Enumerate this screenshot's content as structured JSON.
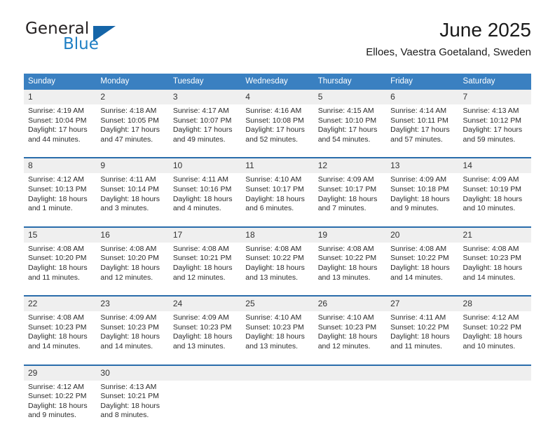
{
  "brand": {
    "word_one": "General",
    "word_two": "Blue",
    "logo_color": "#1565a8"
  },
  "header": {
    "title": "June 2025",
    "subtitle": "Elloes, Vaestra Goetaland, Sweden"
  },
  "calendar": {
    "header_bg": "#3a80c1",
    "weekdays": [
      "Sunday",
      "Monday",
      "Tuesday",
      "Wednesday",
      "Thursday",
      "Friday",
      "Saturday"
    ],
    "weeks": [
      [
        {
          "day": "1",
          "sunrise": "Sunrise: 4:19 AM",
          "sunset": "Sunset: 10:04 PM",
          "daylight": "Daylight: 17 hours and 44 minutes."
        },
        {
          "day": "2",
          "sunrise": "Sunrise: 4:18 AM",
          "sunset": "Sunset: 10:05 PM",
          "daylight": "Daylight: 17 hours and 47 minutes."
        },
        {
          "day": "3",
          "sunrise": "Sunrise: 4:17 AM",
          "sunset": "Sunset: 10:07 PM",
          "daylight": "Daylight: 17 hours and 49 minutes."
        },
        {
          "day": "4",
          "sunrise": "Sunrise: 4:16 AM",
          "sunset": "Sunset: 10:08 PM",
          "daylight": "Daylight: 17 hours and 52 minutes."
        },
        {
          "day": "5",
          "sunrise": "Sunrise: 4:15 AM",
          "sunset": "Sunset: 10:10 PM",
          "daylight": "Daylight: 17 hours and 54 minutes."
        },
        {
          "day": "6",
          "sunrise": "Sunrise: 4:14 AM",
          "sunset": "Sunset: 10:11 PM",
          "daylight": "Daylight: 17 hours and 57 minutes."
        },
        {
          "day": "7",
          "sunrise": "Sunrise: 4:13 AM",
          "sunset": "Sunset: 10:12 PM",
          "daylight": "Daylight: 17 hours and 59 minutes."
        }
      ],
      [
        {
          "day": "8",
          "sunrise": "Sunrise: 4:12 AM",
          "sunset": "Sunset: 10:13 PM",
          "daylight": "Daylight: 18 hours and 1 minute."
        },
        {
          "day": "9",
          "sunrise": "Sunrise: 4:11 AM",
          "sunset": "Sunset: 10:14 PM",
          "daylight": "Daylight: 18 hours and 3 minutes."
        },
        {
          "day": "10",
          "sunrise": "Sunrise: 4:11 AM",
          "sunset": "Sunset: 10:16 PM",
          "daylight": "Daylight: 18 hours and 4 minutes."
        },
        {
          "day": "11",
          "sunrise": "Sunrise: 4:10 AM",
          "sunset": "Sunset: 10:17 PM",
          "daylight": "Daylight: 18 hours and 6 minutes."
        },
        {
          "day": "12",
          "sunrise": "Sunrise: 4:09 AM",
          "sunset": "Sunset: 10:17 PM",
          "daylight": "Daylight: 18 hours and 7 minutes."
        },
        {
          "day": "13",
          "sunrise": "Sunrise: 4:09 AM",
          "sunset": "Sunset: 10:18 PM",
          "daylight": "Daylight: 18 hours and 9 minutes."
        },
        {
          "day": "14",
          "sunrise": "Sunrise: 4:09 AM",
          "sunset": "Sunset: 10:19 PM",
          "daylight": "Daylight: 18 hours and 10 minutes."
        }
      ],
      [
        {
          "day": "15",
          "sunrise": "Sunrise: 4:08 AM",
          "sunset": "Sunset: 10:20 PM",
          "daylight": "Daylight: 18 hours and 11 minutes."
        },
        {
          "day": "16",
          "sunrise": "Sunrise: 4:08 AM",
          "sunset": "Sunset: 10:20 PM",
          "daylight": "Daylight: 18 hours and 12 minutes."
        },
        {
          "day": "17",
          "sunrise": "Sunrise: 4:08 AM",
          "sunset": "Sunset: 10:21 PM",
          "daylight": "Daylight: 18 hours and 12 minutes."
        },
        {
          "day": "18",
          "sunrise": "Sunrise: 4:08 AM",
          "sunset": "Sunset: 10:22 PM",
          "daylight": "Daylight: 18 hours and 13 minutes."
        },
        {
          "day": "19",
          "sunrise": "Sunrise: 4:08 AM",
          "sunset": "Sunset: 10:22 PM",
          "daylight": "Daylight: 18 hours and 13 minutes."
        },
        {
          "day": "20",
          "sunrise": "Sunrise: 4:08 AM",
          "sunset": "Sunset: 10:22 PM",
          "daylight": "Daylight: 18 hours and 14 minutes."
        },
        {
          "day": "21",
          "sunrise": "Sunrise: 4:08 AM",
          "sunset": "Sunset: 10:23 PM",
          "daylight": "Daylight: 18 hours and 14 minutes."
        }
      ],
      [
        {
          "day": "22",
          "sunrise": "Sunrise: 4:08 AM",
          "sunset": "Sunset: 10:23 PM",
          "daylight": "Daylight: 18 hours and 14 minutes."
        },
        {
          "day": "23",
          "sunrise": "Sunrise: 4:09 AM",
          "sunset": "Sunset: 10:23 PM",
          "daylight": "Daylight: 18 hours and 14 minutes."
        },
        {
          "day": "24",
          "sunrise": "Sunrise: 4:09 AM",
          "sunset": "Sunset: 10:23 PM",
          "daylight": "Daylight: 18 hours and 13 minutes."
        },
        {
          "day": "25",
          "sunrise": "Sunrise: 4:10 AM",
          "sunset": "Sunset: 10:23 PM",
          "daylight": "Daylight: 18 hours and 13 minutes."
        },
        {
          "day": "26",
          "sunrise": "Sunrise: 4:10 AM",
          "sunset": "Sunset: 10:23 PM",
          "daylight": "Daylight: 18 hours and 12 minutes."
        },
        {
          "day": "27",
          "sunrise": "Sunrise: 4:11 AM",
          "sunset": "Sunset: 10:22 PM",
          "daylight": "Daylight: 18 hours and 11 minutes."
        },
        {
          "day": "28",
          "sunrise": "Sunrise: 4:12 AM",
          "sunset": "Sunset: 10:22 PM",
          "daylight": "Daylight: 18 hours and 10 minutes."
        }
      ],
      [
        {
          "day": "29",
          "sunrise": "Sunrise: 4:12 AM",
          "sunset": "Sunset: 10:22 PM",
          "daylight": "Daylight: 18 hours and 9 minutes."
        },
        {
          "day": "30",
          "sunrise": "Sunrise: 4:13 AM",
          "sunset": "Sunset: 10:21 PM",
          "daylight": "Daylight: 18 hours and 8 minutes."
        },
        {
          "day": "",
          "sunrise": "",
          "sunset": "",
          "daylight": ""
        },
        {
          "day": "",
          "sunrise": "",
          "sunset": "",
          "daylight": ""
        },
        {
          "day": "",
          "sunrise": "",
          "sunset": "",
          "daylight": ""
        },
        {
          "day": "",
          "sunrise": "",
          "sunset": "",
          "daylight": ""
        },
        {
          "day": "",
          "sunrise": "",
          "sunset": "",
          "daylight": ""
        }
      ]
    ]
  }
}
